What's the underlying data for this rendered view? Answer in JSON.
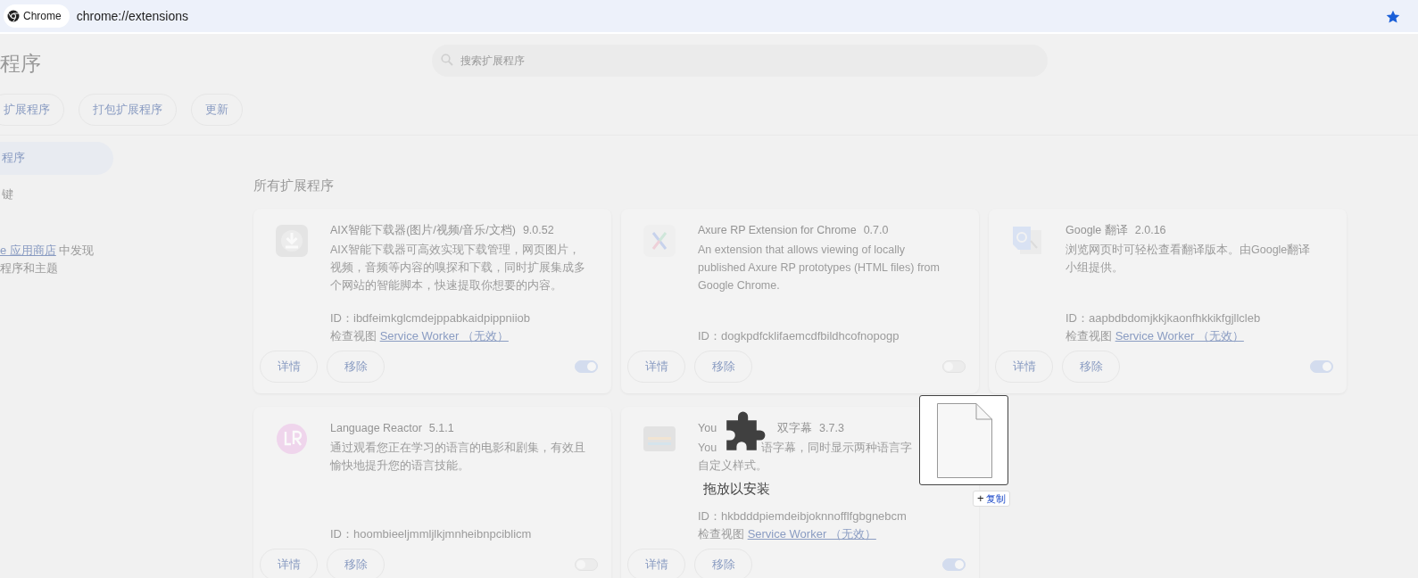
{
  "address_bar": {
    "chip": "Chrome",
    "url": "chrome://extensions",
    "bookmarked": true
  },
  "header": {
    "title": "程序",
    "search": {
      "placeholder": "搜索扩展程序"
    }
  },
  "toolbar": [
    "扩展程序",
    "打包扩展程序",
    "更新"
  ],
  "sidebar": {
    "items": [
      {
        "label": "程序",
        "selected": true
      },
      {
        "label": "键",
        "selected": false
      }
    ],
    "store_link": "e 应用商店",
    "store_text": "中发现",
    "store_text_2": "程序和主题"
  },
  "section_title": "所有扩展程序",
  "extensions": [
    {
      "name_parts": [
        "AIX智能下载器(图片/视频/音乐/文档)"
      ],
      "version": "9.0.52",
      "description_lines": [
        [
          "AIX智能下载器可高效实现下载管理，网页图片，"
        ],
        [
          "视频，音频等内容的嗅探和下载，同时扩展集成多"
        ],
        [
          "个网站的智能脚本，快速提取你想要的内容。"
        ]
      ],
      "id": "ID：ibdfeimkglcmdejppabkaidpippniiob",
      "inspect_label": "检查视图",
      "inspect_link": "Service Worker （无效）",
      "buttons": [
        "详情",
        "移除"
      ],
      "enabled": true
    },
    {
      "name_parts": [
        "Axure RP Extension for Chrome"
      ],
      "version": "0.7.0",
      "description_lines": [
        [
          "An extension that allows viewing of locally"
        ],
        [
          "published Axure RP prototypes (HTML files) from"
        ],
        [
          "Google Chrome."
        ]
      ],
      "id": "ID：dogkpdfcklifaemcdfbildhcofnopogp",
      "buttons": [
        "详情",
        "移除"
      ],
      "enabled": false
    },
    {
      "name_parts": [
        "Google 翻译"
      ],
      "version": "2.0.16",
      "description_lines": [
        [
          "浏览网页时可轻松查看翻译版本。由Google翻译"
        ],
        [
          "小组提供。"
        ]
      ],
      "id": "ID：aapbdbdomjkkjkaonfhkkikfgjllcleb",
      "inspect_label": "检查视图",
      "inspect_link": "Service Worker （无效）",
      "buttons": [
        "详情",
        "移除"
      ],
      "enabled": true
    },
    {
      "name_parts": [
        "Language Reactor"
      ],
      "version": "5.1.1",
      "description_lines": [
        [
          "通过观看您正在学习的语言的电影和剧集，有效且"
        ],
        [
          "愉快地提升您的语言技能。"
        ]
      ],
      "id": "ID：hoombieeljmmljlkjmnheibnpciblicm",
      "buttons": [
        "详情",
        "移除"
      ],
      "enabled": false
    },
    {
      "name_parts": [
        "You",
        "双字幕"
      ],
      "version": "3.7.3",
      "description_lines": [
        [
          "You",
          "语字幕，同时显示两种语言字"
        ],
        [
          "自定义样式。"
        ]
      ],
      "id": "ID：hkbdddpiemdeibjoknnofflfgbgnebcm",
      "inspect_label": "检查视图",
      "inspect_link": "Service Worker （无效）",
      "buttons": [
        "详情",
        "移除"
      ],
      "enabled": true
    }
  ],
  "drop_overlay": {
    "label": "拖放以安装",
    "badge_symbol": "+",
    "badge": "复制"
  }
}
